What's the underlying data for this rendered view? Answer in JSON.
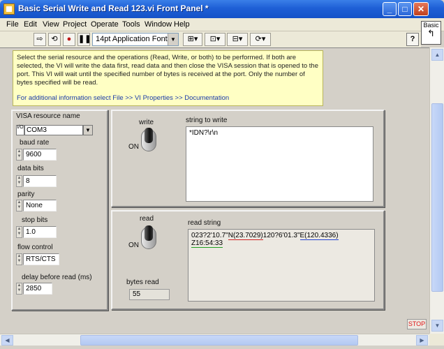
{
  "window": {
    "title": "Basic Serial Write and Read 123.vi Front Panel *",
    "minimize_glyph": "_",
    "maximize_glyph": "□",
    "close_glyph": "✕"
  },
  "menu": {
    "items": [
      {
        "label": "File"
      },
      {
        "label": "Edit"
      },
      {
        "label": "View"
      },
      {
        "label": "Project"
      },
      {
        "label": "Operate"
      },
      {
        "label": "Tools"
      },
      {
        "label": "Window"
      },
      {
        "label": "Help"
      }
    ]
  },
  "toolbar": {
    "run_icon": "run-arrow-icon",
    "run_continuous_icon": "run-continuously-icon",
    "abort_icon": "abort-icon",
    "pause_icon": "pause-icon",
    "font_label": "14pt Application Font",
    "align_icon": "align-objects-icon",
    "distribute_icon": "distribute-objects-icon",
    "resize_icon": "resize-objects-icon",
    "reorder_icon": "reorder-icon",
    "help_label": "?",
    "palette_label": "Basic"
  },
  "description": {
    "text": "Select the serial resource and the operations (Read, Write, or both) to be performed.  If both are selected, the VI will write the data first, read data and then close the VISA session that is opened to the port.  This VI will wait until the specified number of bytes is received at the port. Only the number of bytes specified will be read.",
    "link": "For additional information select File >> VI Properties >> Documentation"
  },
  "settings": {
    "visa_label": "VISA resource name",
    "visa_value": "COM3",
    "baud_label": "baud rate",
    "baud_value": "9600",
    "data_bits_label": "data bits",
    "data_bits_value": "8",
    "parity_label": "parity",
    "parity_value": "None",
    "stop_bits_label": "stop bits",
    "stop_bits_value": "1.0",
    "flow_label": "flow control",
    "flow_value": "RTS/CTS",
    "delay_label": "delay before read (ms)",
    "delay_value": "2850"
  },
  "write": {
    "toggle_label": "write",
    "toggle_state": "ON",
    "string_label": "string to write",
    "string_value": "*IDN?\\r\\n"
  },
  "read": {
    "toggle_label": "read",
    "toggle_state": "ON",
    "string_label": "read string",
    "string_prefix": "023?2'10.7\"",
    "string_n": "N(23.7029)",
    "string_mid": "120?6'01.3\"",
    "string_e": "E(120.4336)",
    "string_sp": " ",
    "string_z": "Z16:54:33",
    "bytes_label": "bytes read",
    "bytes_value": "55"
  },
  "stop_label": "STOP",
  "colors": {
    "title_bar": "#1e5fd6",
    "description_bg": "#ffffc4",
    "stop_text": "#e01818"
  }
}
